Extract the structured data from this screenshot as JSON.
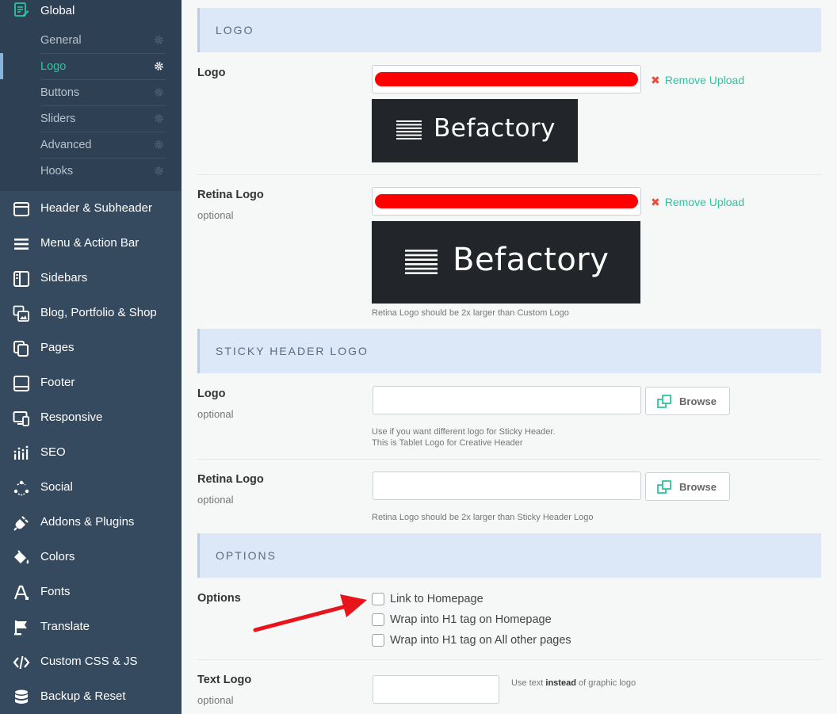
{
  "sidebar": {
    "global_label": "Global",
    "sub_items": [
      {
        "label": "General"
      },
      {
        "label": "Logo"
      },
      {
        "label": "Buttons"
      },
      {
        "label": "Sliders"
      },
      {
        "label": "Advanced"
      },
      {
        "label": "Hooks"
      }
    ],
    "active_sub_item": "Logo",
    "items": [
      {
        "label": "Header & Subheader",
        "icon": "window-icon"
      },
      {
        "label": "Menu & Action Bar",
        "icon": "menu-icon"
      },
      {
        "label": "Sidebars",
        "icon": "sidebar-icon"
      },
      {
        "label": "Blog, Portfolio & Shop",
        "icon": "gallery-icon"
      },
      {
        "label": "Pages",
        "icon": "pages-icon"
      },
      {
        "label": "Footer",
        "icon": "footer-icon"
      },
      {
        "label": "Responsive",
        "icon": "responsive-icon"
      },
      {
        "label": "SEO",
        "icon": "seo-icon"
      },
      {
        "label": "Social",
        "icon": "social-icon"
      },
      {
        "label": "Addons & Plugins",
        "icon": "plug-icon"
      },
      {
        "label": "Colors",
        "icon": "paint-bucket-icon"
      },
      {
        "label": "Fonts",
        "icon": "font-icon"
      },
      {
        "label": "Translate",
        "icon": "flag-icon"
      },
      {
        "label": "Custom CSS & JS",
        "icon": "code-icon"
      },
      {
        "label": "Backup & Reset",
        "icon": "database-icon"
      }
    ]
  },
  "main": {
    "logo_section": {
      "heading": "LOGO",
      "logo": {
        "title": "Logo",
        "remove_label": "Remove Upload",
        "preview_text": "Befactory"
      },
      "retina_logo": {
        "title": "Retina Logo",
        "subtitle": "optional",
        "remove_label": "Remove Upload",
        "preview_text": "Befactory",
        "hint": "Retina Logo should be 2x larger than Custom Logo"
      }
    },
    "sticky_section": {
      "heading": "STICKY HEADER LOGO",
      "logo": {
        "title": "Logo",
        "subtitle": "optional",
        "browse_label": "Browse",
        "hint_line1": "Use if you want different logo for Sticky Header.",
        "hint_line2": "This is Tablet Logo for Creative Header"
      },
      "retina_logo": {
        "title": "Retina Logo",
        "subtitle": "optional",
        "browse_label": "Browse",
        "hint": "Retina Logo should be 2x larger than Sticky Header Logo"
      }
    },
    "options_section": {
      "heading": "OPTIONS",
      "options": {
        "title": "Options",
        "checkboxes": [
          {
            "label": "Link to Homepage",
            "checked": false
          },
          {
            "label": "Wrap into H1 tag on Homepage",
            "checked": false
          },
          {
            "label": "Wrap into H1 tag on All other pages",
            "checked": false
          }
        ]
      },
      "text_logo": {
        "title": "Text Logo",
        "subtitle": "optional",
        "hint_prefix": "Use text ",
        "hint_bold": "instead",
        "hint_suffix": " of graphic logo"
      }
    }
  },
  "colors": {
    "accent": "#2ec4a0",
    "sidebar_bg": "#354a5e",
    "section_bg": "#dce8f7",
    "annotation_arrow": "#e8141b"
  }
}
